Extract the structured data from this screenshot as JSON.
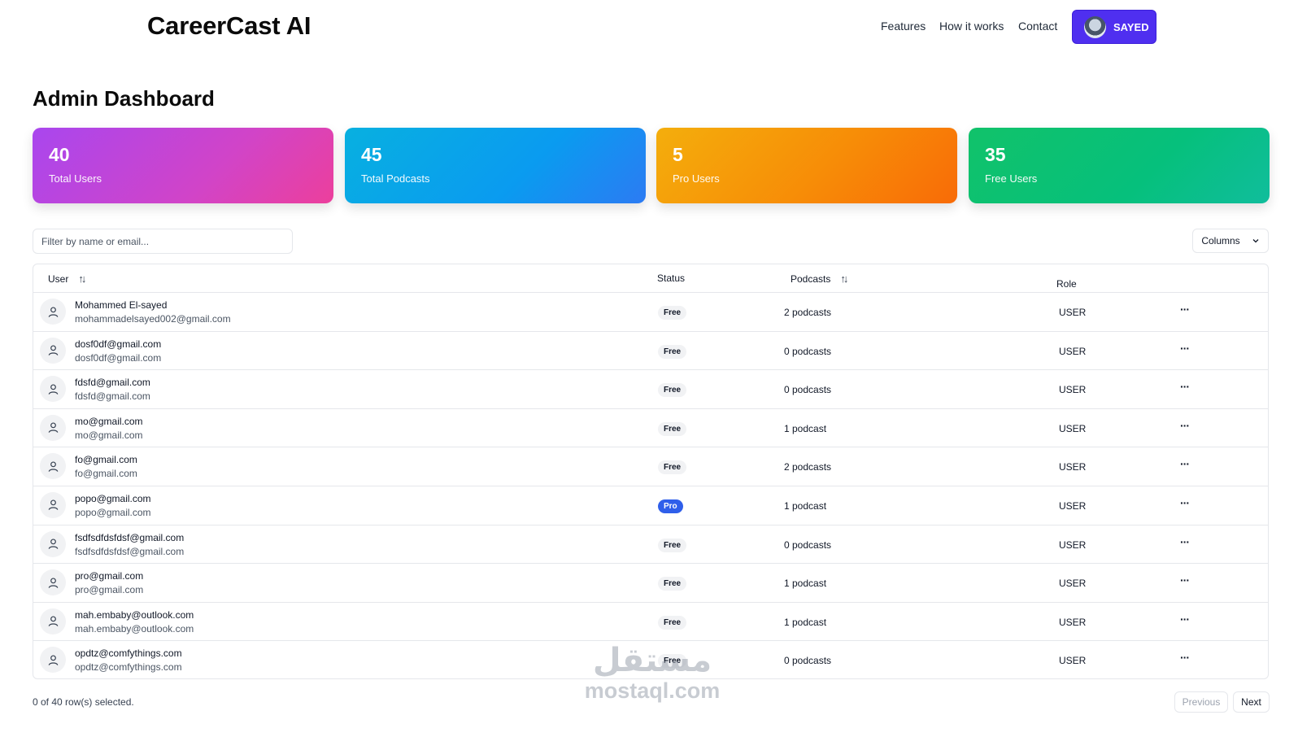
{
  "header": {
    "brand": "CareerCast AI",
    "nav": [
      "Features",
      "How it works",
      "Contact"
    ],
    "user_label": "SAYED"
  },
  "page": {
    "title": "Admin Dashboard"
  },
  "stats": [
    {
      "value": "40",
      "label": "Total Users"
    },
    {
      "value": "45",
      "label": "Total Podcasts"
    },
    {
      "value": "5",
      "label": "Pro Users"
    },
    {
      "value": "35",
      "label": "Free Users"
    }
  ],
  "filter": {
    "placeholder": "Filter by name or email..."
  },
  "columns_button": "Columns",
  "table": {
    "headers": {
      "user": "User",
      "status": "Status",
      "podcasts": "Podcasts",
      "role": "Role"
    },
    "rows": [
      {
        "name": "Mohammed El-sayed",
        "email": "mohammadelsayed002@gmail.com",
        "status": "Free",
        "podcasts": "2 podcasts",
        "role": "USER"
      },
      {
        "name": "dosf0df@gmail.com",
        "email": "dosf0df@gmail.com",
        "status": "Free",
        "podcasts": "0 podcasts",
        "role": "USER"
      },
      {
        "name": "fdsfd@gmail.com",
        "email": "fdsfd@gmail.com",
        "status": "Free",
        "podcasts": "0 podcasts",
        "role": "USER"
      },
      {
        "name": "mo@gmail.com",
        "email": "mo@gmail.com",
        "status": "Free",
        "podcasts": "1 podcast",
        "role": "USER"
      },
      {
        "name": "fo@gmail.com",
        "email": "fo@gmail.com",
        "status": "Free",
        "podcasts": "2 podcasts",
        "role": "USER"
      },
      {
        "name": "popo@gmail.com",
        "email": "popo@gmail.com",
        "status": "Pro",
        "podcasts": "1 podcast",
        "role": "USER"
      },
      {
        "name": "fsdfsdfdsfdsf@gmail.com",
        "email": "fsdfsdfdsfdsf@gmail.com",
        "status": "Free",
        "podcasts": "0 podcasts",
        "role": "USER"
      },
      {
        "name": "pro@gmail.com",
        "email": "pro@gmail.com",
        "status": "Free",
        "podcasts": "1 podcast",
        "role": "USER"
      },
      {
        "name": "mah.embaby@outlook.com",
        "email": "mah.embaby@outlook.com",
        "status": "Free",
        "podcasts": "1 podcast",
        "role": "USER"
      },
      {
        "name": "opdtz@comfythings.com",
        "email": "opdtz@comfythings.com",
        "status": "Free",
        "podcasts": "0 podcasts",
        "role": "USER"
      }
    ],
    "row_actions_label": "···"
  },
  "footer": {
    "selection": "0 of 40 row(s) selected.",
    "previous": "Previous",
    "next": "Next"
  },
  "watermark": {
    "arabic": "مستقل",
    "latin": "mostaql.com"
  },
  "colors": {
    "accent": "#4f2ff0",
    "pro_badge": "#2f5fea"
  }
}
